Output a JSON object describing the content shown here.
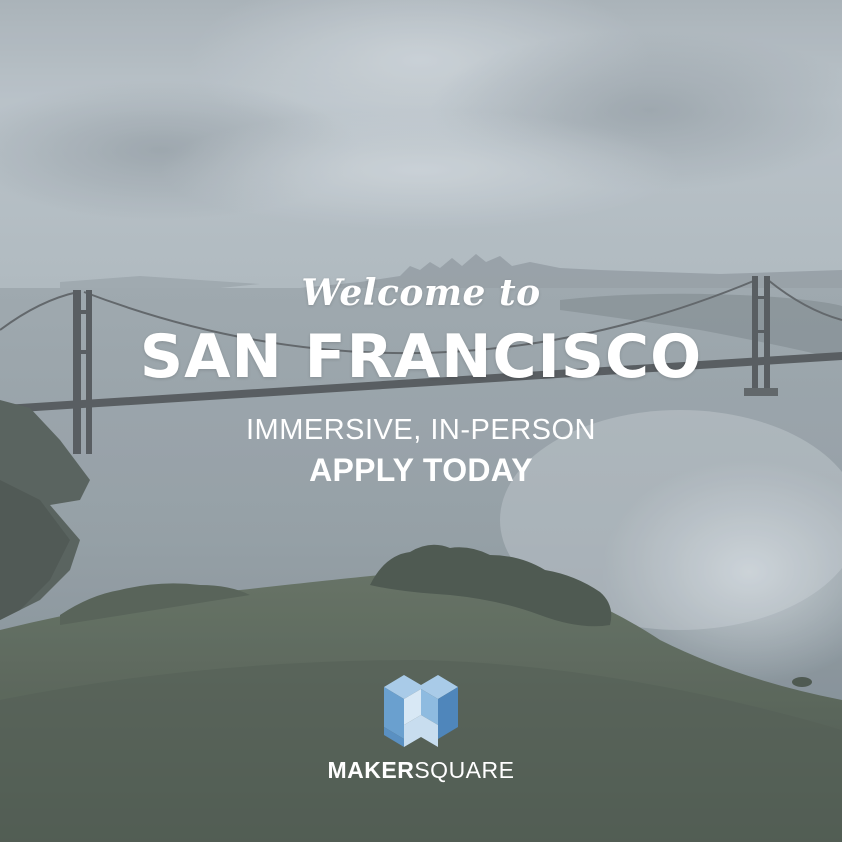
{
  "headline": {
    "script": "Welcome to",
    "main": "SAN FRANCISCO"
  },
  "subline": "IMMERSIVE, IN-PERSON",
  "cta": "APPLY TODAY",
  "brand": {
    "bold_part": "MAKER",
    "light_part": "SQUARE"
  },
  "icons": {
    "logo": "makersquare-cube-logo"
  },
  "colors": {
    "text": "#ffffff",
    "sky": "#b9c2c8",
    "water": "#8f9aa1",
    "hills": "#4f5c4f",
    "bridge": "#4b4f52",
    "logo_light": "#a8c9e6",
    "logo_mid": "#6ea0cc",
    "logo_dark": "#4f86bb"
  }
}
